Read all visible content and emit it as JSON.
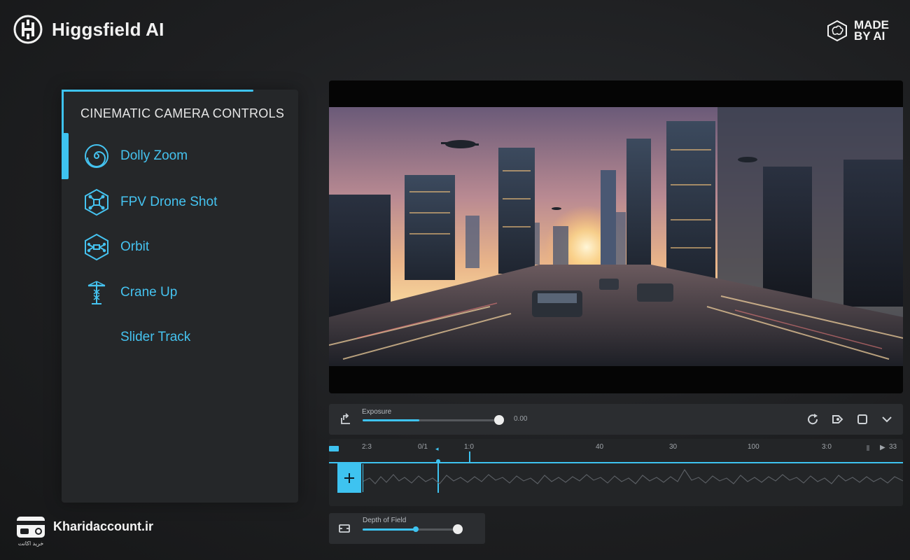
{
  "brand": {
    "name": "Higgsfield AI"
  },
  "badge": {
    "line1": "MADE",
    "line2": "BY AI"
  },
  "panel": {
    "title": "CINEMATIC CAMERA CONTROLS",
    "items": [
      {
        "label": "Dolly Zoom",
        "icon": "spiral-icon",
        "active": true
      },
      {
        "label": "FPV Drone Shot",
        "icon": "drone-icon",
        "active": false
      },
      {
        "label": "Orbit",
        "icon": "orbit-drone-icon",
        "active": false
      },
      {
        "label": "Crane Up",
        "icon": "crane-icon",
        "active": false
      },
      {
        "label": "Slider Track",
        "icon": "",
        "active": false
      }
    ]
  },
  "controls": {
    "exposure_label": "Exposure",
    "exposure_fraction": 0.42,
    "exposure_value": "0.00"
  },
  "timeline": {
    "ruler": [
      "2:3",
      "0/1",
      "1:0",
      "40",
      "30",
      "100",
      "3:0",
      "33"
    ]
  },
  "dof": {
    "label": "Depth of Field",
    "fraction": 0.55
  },
  "watermark": {
    "name": "Kharidaccount.ir",
    "sub": "خرید اکانت"
  },
  "colors": {
    "accent": "#3ec3f0",
    "panel": "#252729"
  }
}
